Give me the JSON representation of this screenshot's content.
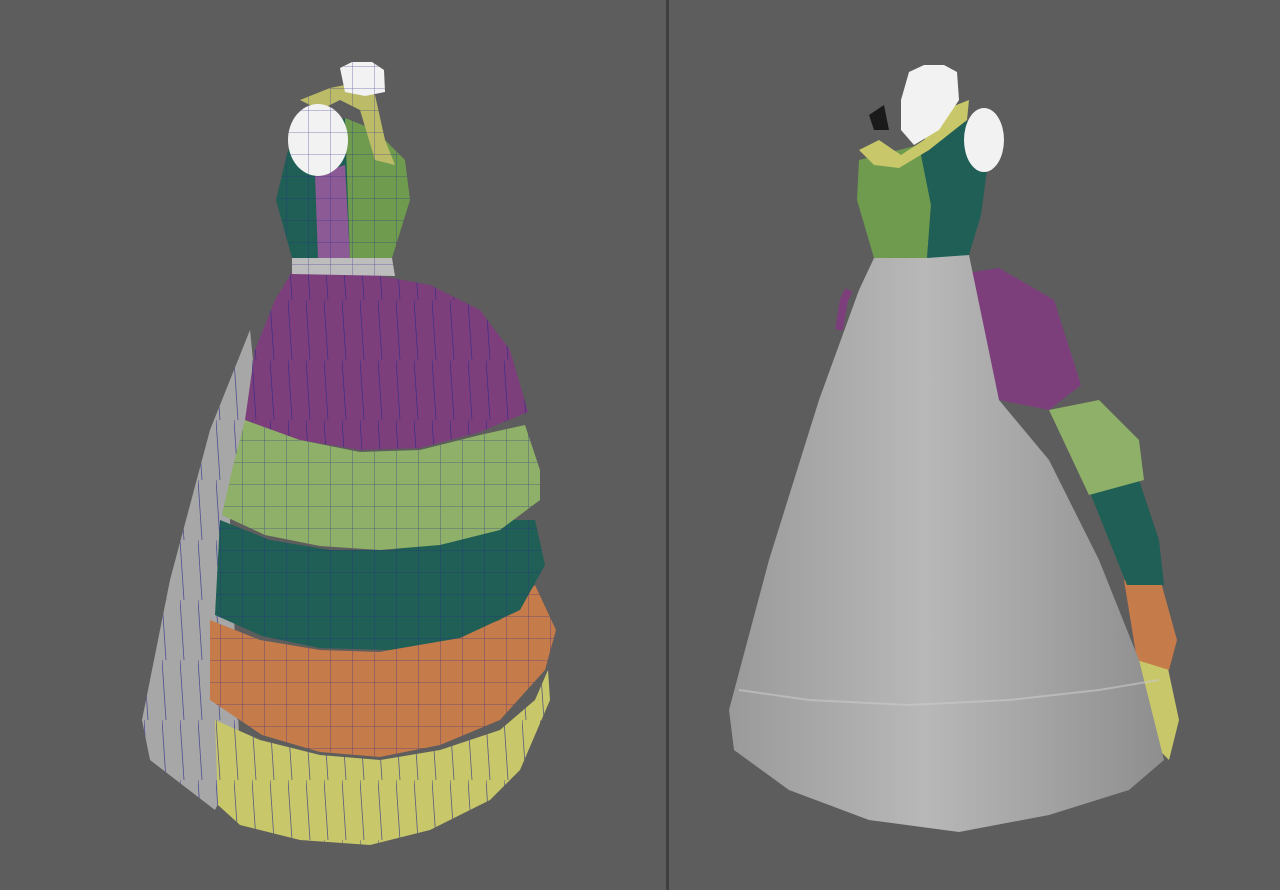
{
  "viewports": {
    "left": {
      "mode": "wireframe-on-shaded"
    },
    "right": {
      "mode": "shaded"
    }
  },
  "colors": {
    "background": "#5d5d5d",
    "divider": "#3f3f3f",
    "mannequin": "#f2f2f2",
    "purple": "#7d3f7c",
    "light_green": "#8fb068",
    "teal": "#1f5f55",
    "orange": "#c67b4a",
    "yellow": "#c8c86a",
    "grey_skirt": "#a7a7a7",
    "bodice_green": "#6f9b4f",
    "wire": "#2a2a8a"
  },
  "model": {
    "parts": [
      "mannequin",
      "bodice",
      "ruffle-collar",
      "waistband",
      "purple-tier",
      "light-green-tier",
      "teal-tier",
      "orange-tier",
      "yellow-tier",
      "underskirt"
    ]
  }
}
